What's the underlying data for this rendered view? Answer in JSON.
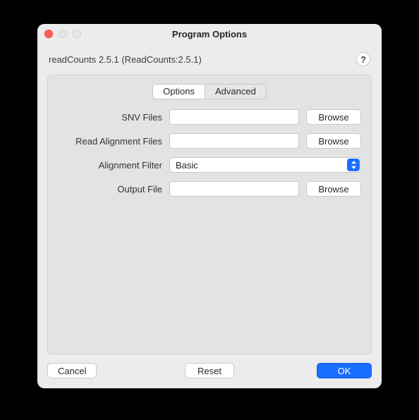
{
  "window": {
    "title": "Program Options"
  },
  "header": {
    "subtitle": "readCounts 2.5.1 (ReadCounts:2.5.1)",
    "help_label": "?"
  },
  "tabs": {
    "options": "Options",
    "advanced": "Advanced",
    "active": "Options"
  },
  "fields": {
    "snv_files": {
      "label": "SNV Files",
      "value": "",
      "browse": "Browse"
    },
    "read_alignment_files": {
      "label": "Read Alignment Files",
      "value": "",
      "browse": "Browse"
    },
    "alignment_filter": {
      "label": "Alignment Filter",
      "value": "Basic"
    },
    "output_file": {
      "label": "Output File",
      "value": "",
      "browse": "Browse"
    }
  },
  "footer": {
    "cancel": "Cancel",
    "reset": "Reset",
    "ok": "OK"
  }
}
